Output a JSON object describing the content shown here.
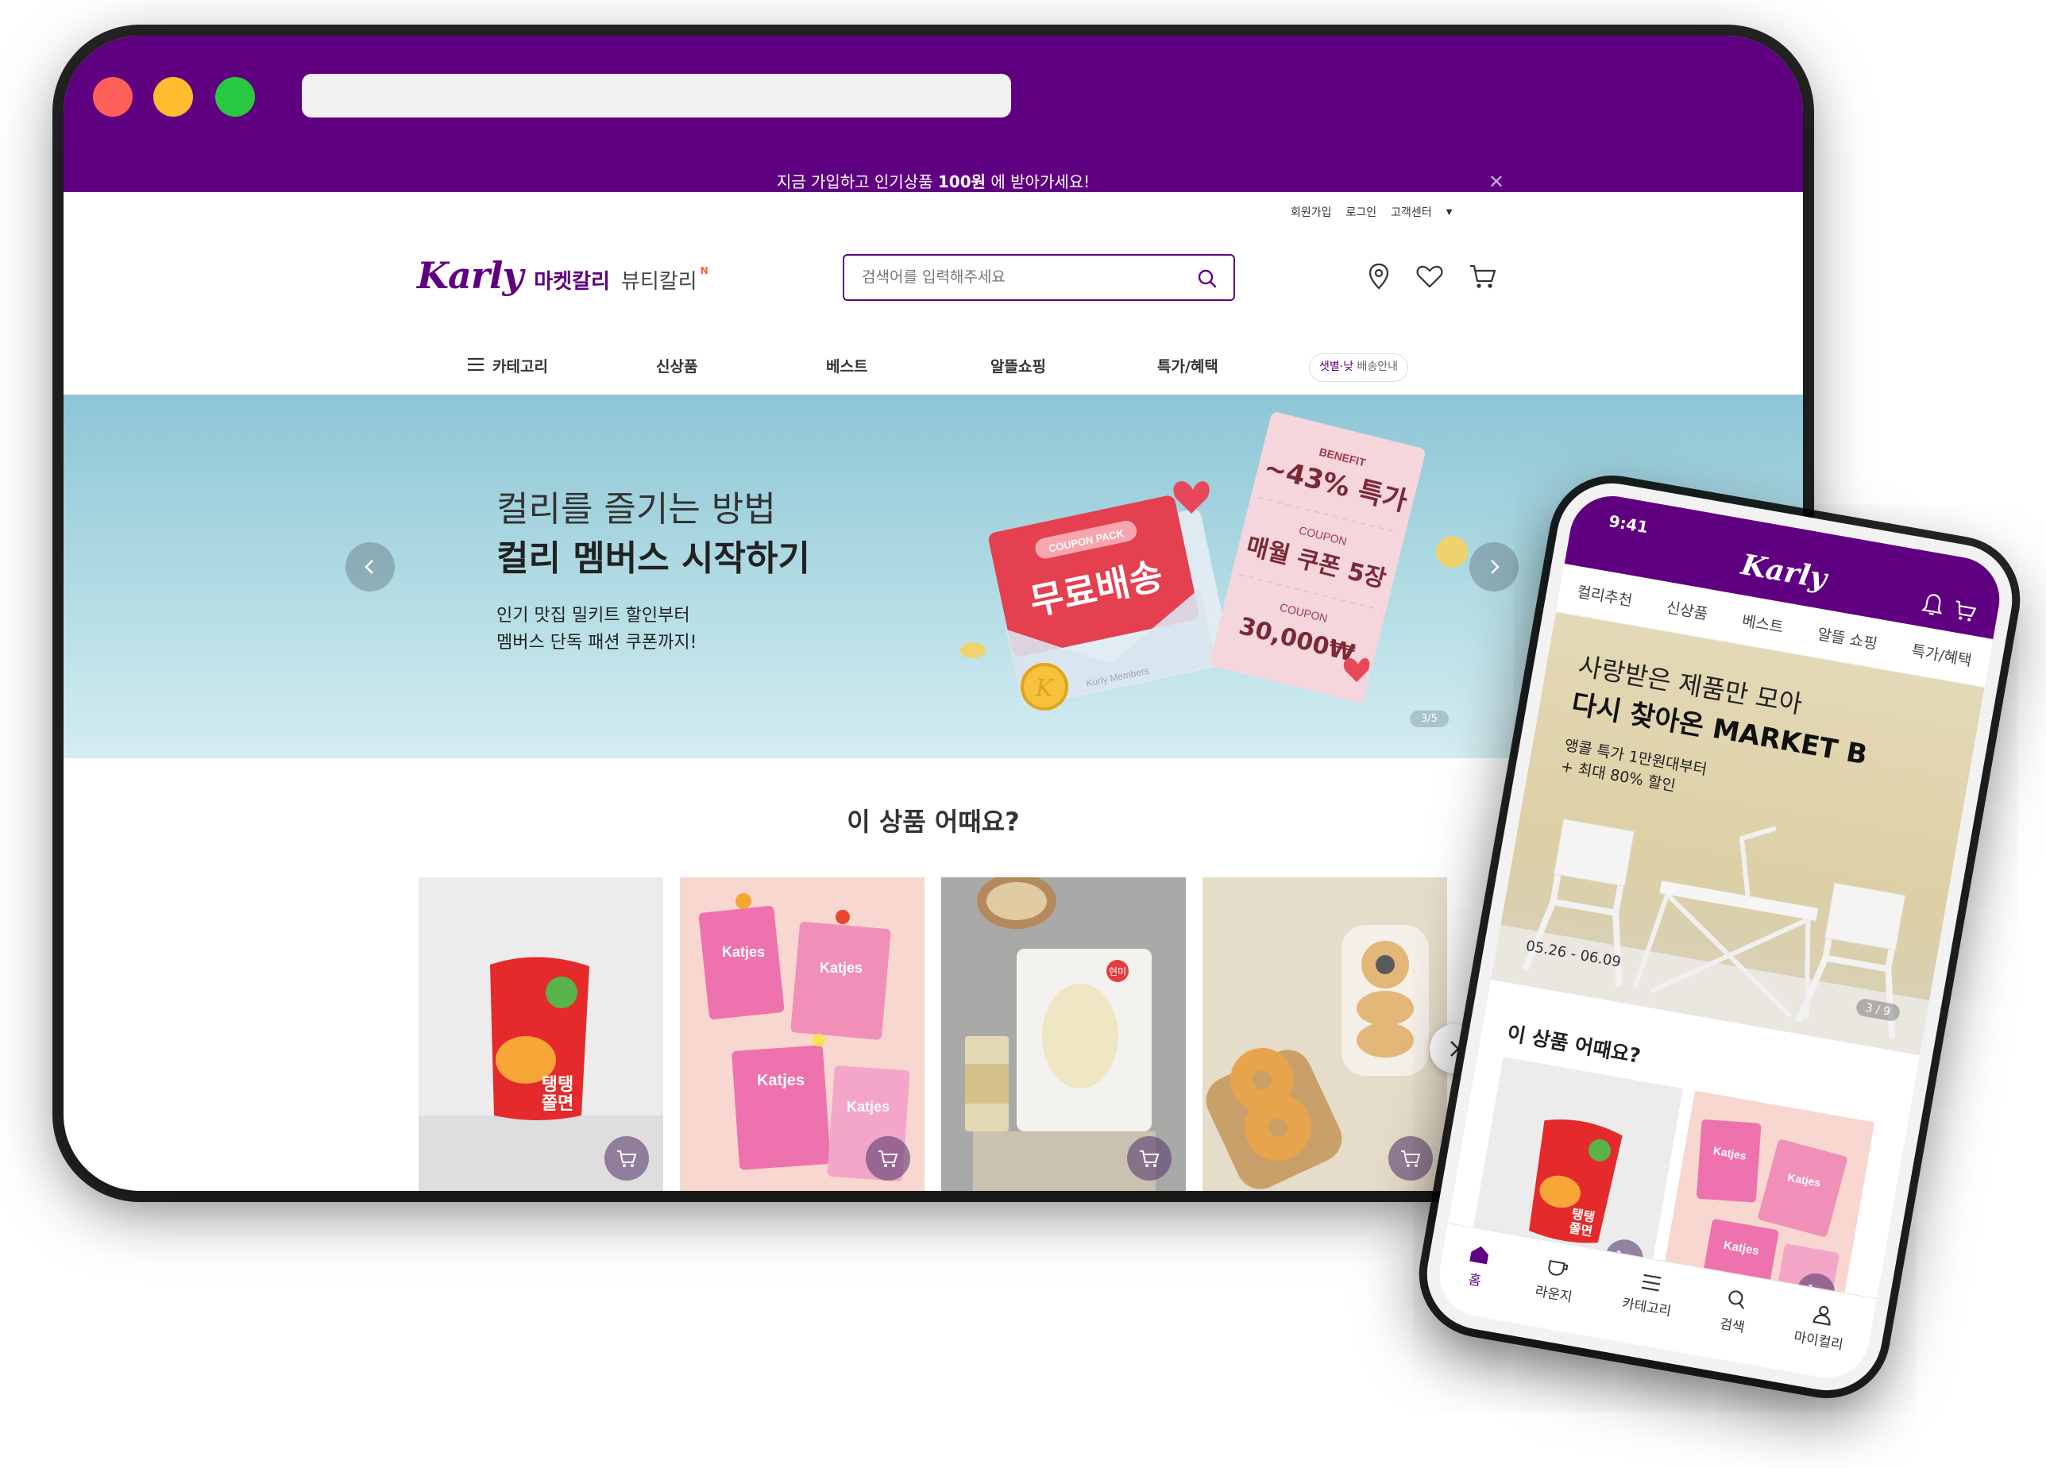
{
  "promo": {
    "pre": "지금 가입하고 인기상품 ",
    "bold": "100원",
    "post": " 에 받아가세요!",
    "close": "✕"
  },
  "topnav": {
    "signup": "회원가입",
    "login": "로그인",
    "support": "고객센터"
  },
  "logo": {
    "script": "Karly",
    "market": "마켓칼리",
    "beauty": "뷰티칼리",
    "new_badge": "N"
  },
  "search": {
    "placeholder": "검색어를 입력해주세요"
  },
  "gnb": {
    "category": "카테고리",
    "new": "신상품",
    "best": "베스트",
    "thrift": "알뜰쇼핑",
    "benefit": "특가/혜택",
    "delivery_highlight": "샛별·낮",
    "delivery_rest": " 배송안내"
  },
  "banner": {
    "subtitle": "컬리를 즐기는 방법",
    "title": "컬리 멤버스 시작하기",
    "desc1": "인기 맛집 밀키트 할인부터",
    "desc2": "멤버스 단독 패션 쿠폰까지!",
    "pager": "3/5",
    "coupon_pack": "COUPON PACK",
    "free_delivery": "무료배송",
    "members": "Kurly Members",
    "benefit": "BENEFIT",
    "benefit_value": "~43% 특가",
    "coupon": "COUPON",
    "coupon_value": "매월 쿠폰 5장",
    "coupon2": "COUPON",
    "coupon2_value": "30,000₩"
  },
  "section": {
    "title": "이 상품 어때요?"
  },
  "products": [
    {
      "name": "탱탱 쫄면",
      "brand_text": "탱탱\n쫄면"
    },
    {
      "name": "Katjes",
      "brand_text": "Katjes"
    },
    {
      "name": "현미",
      "brand_text": "현미"
    },
    {
      "name": "베이글",
      "brand_text": ""
    }
  ],
  "phone": {
    "time": "9:41",
    "logo": "Karly",
    "tabs": [
      "컬리추천",
      "신상품",
      "베스트",
      "알뜰 쇼핑",
      "특가/혜택"
    ],
    "banner_t1": "사랑받은 제품만 모아",
    "banner_t2": "다시 찾아온 MARKET B",
    "banner_d1": "앵콜 특가 1만원대부터",
    "banner_d2": "+ 최대 80% 할인",
    "banner_date": "05.26 - 06.09",
    "banner_pager": "3 / 9",
    "section": "이 상품 어때요?",
    "bottom_nav": [
      "홈",
      "라운지",
      "카테고리",
      "검색",
      "마이컬리"
    ]
  },
  "colors": {
    "brand": "#5f0080",
    "banner_bg": "#b3dce4",
    "accent_orange": "#fa622f"
  }
}
